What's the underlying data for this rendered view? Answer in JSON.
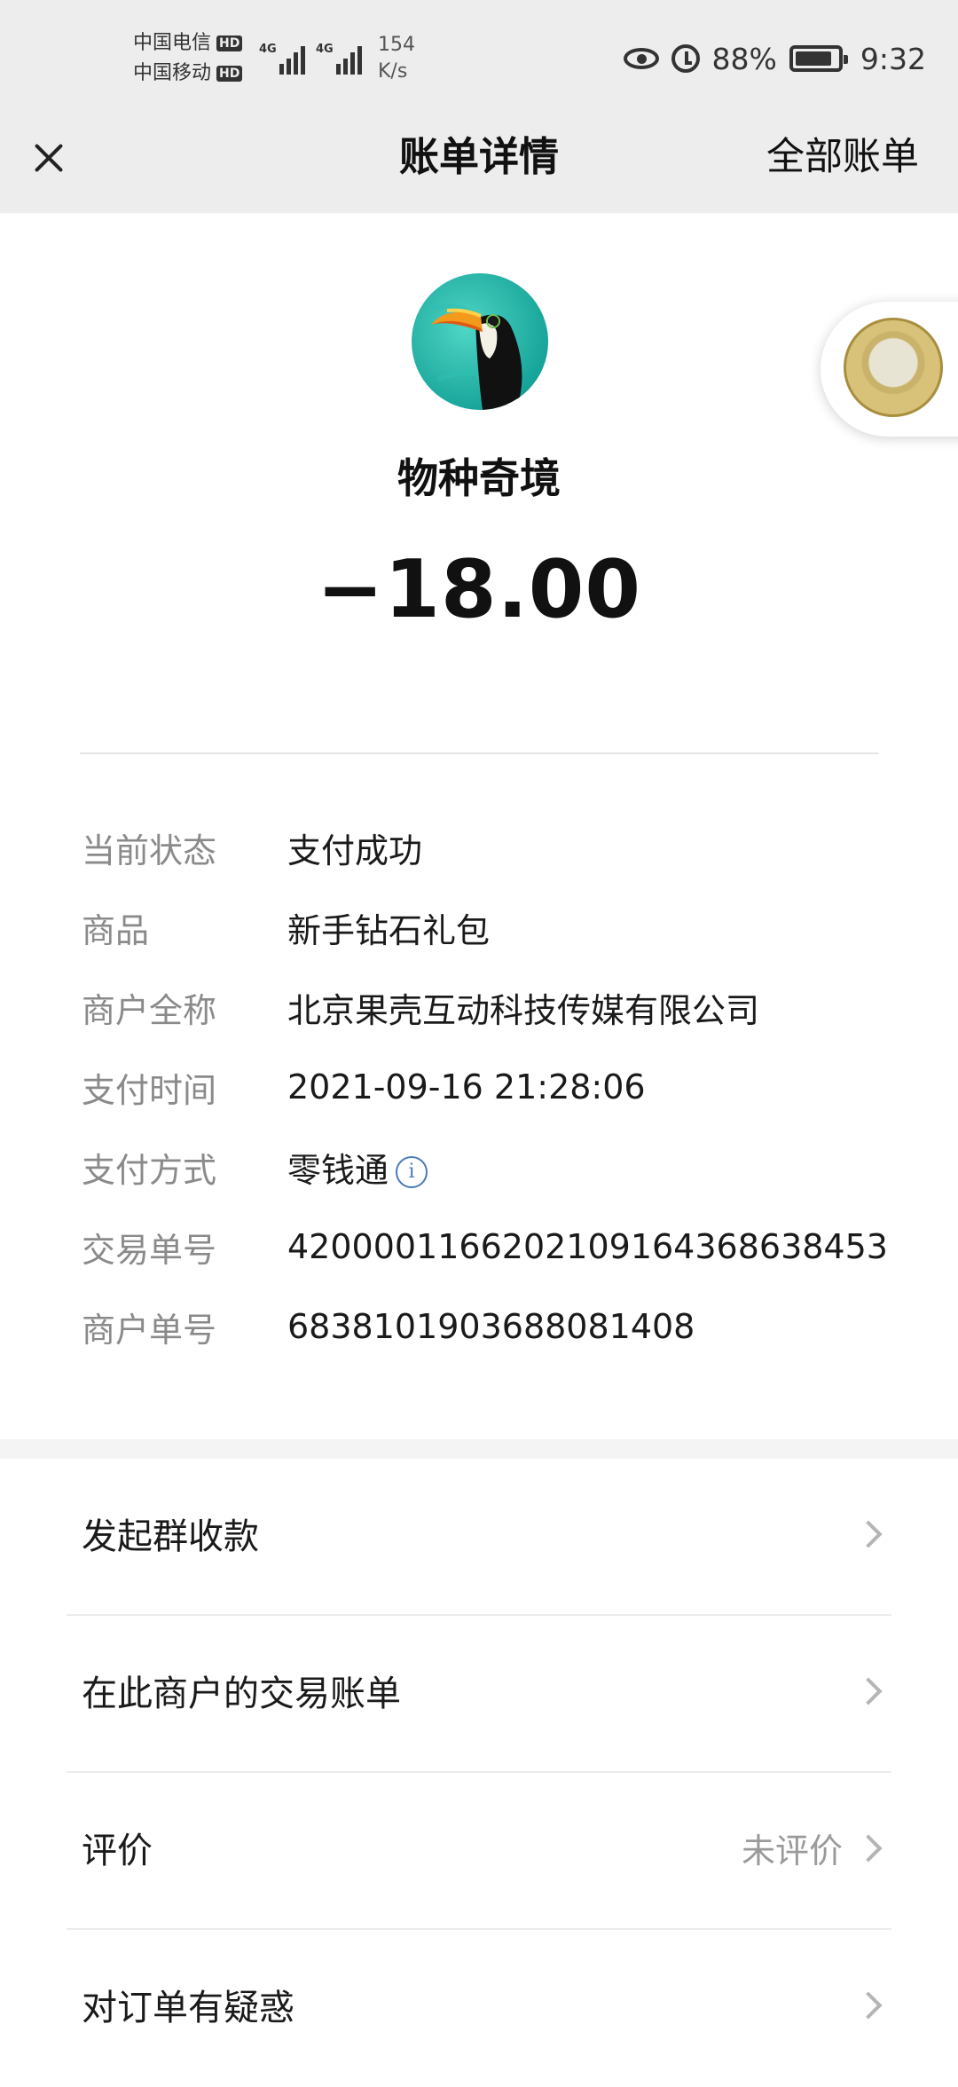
{
  "status_bar": {
    "carrier1": "中国电信",
    "carrier2": "中国移动",
    "hd_badge": "HD",
    "network1": "4G",
    "network2": "4G",
    "speed_value": "154",
    "speed_unit": "K/s",
    "battery": "88%",
    "battery_level": 0.88,
    "time": "9:32"
  },
  "nav": {
    "title": "账单详情",
    "right_label": "全部账单"
  },
  "merchant": {
    "name": "物种奇境",
    "amount": "−18.00"
  },
  "details": [
    {
      "label": "当前状态",
      "value": "支付成功"
    },
    {
      "label": "商品",
      "value": "新手钻石礼包"
    },
    {
      "label": "商户全称",
      "value": "北京果壳互动科技传媒有限公司"
    },
    {
      "label": "支付时间",
      "value": "2021-09-16 21:28:06"
    },
    {
      "label": "支付方式",
      "value": "零钱通"
    },
    {
      "label": "交易单号",
      "value": "4200001166202109164368638453"
    },
    {
      "label": "商户单号",
      "value": "6838101903688081408"
    }
  ],
  "menu": [
    {
      "label": "发起群收款",
      "right": ""
    },
    {
      "label": "在此商户的交易账单",
      "right": ""
    },
    {
      "label": "评价",
      "right": "未评价"
    },
    {
      "label": "对订单有疑惑",
      "right": ""
    }
  ],
  "colors": {
    "header_bg": "#ededed",
    "label_gray": "#8a8a8a",
    "info_blue": "#4a7ab8",
    "avatar_teal": "#1fb7a8"
  }
}
